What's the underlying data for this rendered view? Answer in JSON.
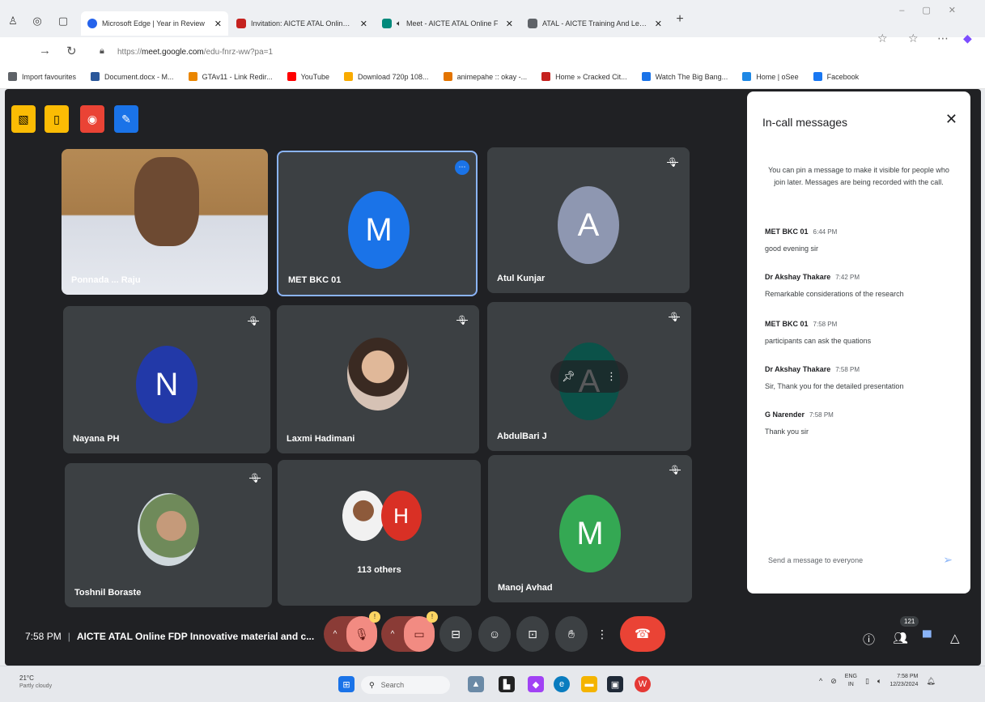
{
  "browser": {
    "tabs": [
      {
        "title": "Microsoft Edge | Year in Review",
        "color": "#2563eb",
        "active": true
      },
      {
        "title": "Invitation: AICTE ATAL Online FDP",
        "color": "#c5221f",
        "active": false
      },
      {
        "title": "Meet - AICTE ATAL Online F",
        "color": "#00897b",
        "active": false
      },
      {
        "title": "ATAL - AICTE Training And Learn",
        "color": "#5f6368",
        "active": false
      }
    ],
    "url_prefix": "https://",
    "url_domain": "meet.google.com",
    "url_path": "/edu-fnrz-ww?pa=1",
    "bookmarks": [
      {
        "label": "Import favourites",
        "color": "#5f6368"
      },
      {
        "label": "Document.docx - M...",
        "color": "#2b579a"
      },
      {
        "label": "GTAv11 - Link Redir...",
        "color": "#ea8600"
      },
      {
        "label": "YouTube",
        "color": "#ff0000"
      },
      {
        "label": "Download 720p 108...",
        "color": "#f9ab00"
      },
      {
        "label": "animepahe :: okay -...",
        "color": "#e37400"
      },
      {
        "label": "Home » Cracked Cit...",
        "color": "#c5221f"
      },
      {
        "label": "Watch The Big Bang...",
        "color": "#1a73e8"
      },
      {
        "label": "Home | oSee",
        "color": "#1e88e5"
      },
      {
        "label": "Facebook",
        "color": "#1877f2"
      }
    ]
  },
  "meet": {
    "participants": [
      {
        "name": "Ponnada ... Raju",
        "type": "photo",
        "muted": false
      },
      {
        "name": "MET BKC 01",
        "type": "avatar",
        "initial": "M",
        "color": "#1a73e8",
        "muted": false,
        "selected": true
      },
      {
        "name": "Atul Kunjar",
        "type": "avatar",
        "initial": "A",
        "color": "#8e97b1",
        "muted": true
      },
      {
        "name": "Nayana PH",
        "type": "avatar",
        "initial": "N",
        "color": "#2239a8",
        "muted": true
      },
      {
        "name": "Laxmi Hadimani",
        "type": "photo",
        "muted": true
      },
      {
        "name": "AbdulBari J",
        "type": "avatar",
        "initial": "A",
        "color": "#0b5249",
        "muted": true
      },
      {
        "name": "Toshnil Boraste",
        "type": "photo",
        "muted": true
      },
      {
        "name": "113 others",
        "type": "others",
        "initial": "H",
        "color": "#d93025",
        "muted": false
      },
      {
        "name": "Manoj Avhad",
        "type": "avatar",
        "initial": "M",
        "color": "#34a853",
        "muted": true
      }
    ],
    "clock": "7:58 PM",
    "meeting_title": "AICTE ATAL Online FDP Innovative material and c...",
    "participant_count": "121",
    "mic_badge": "!",
    "cam_badge": "!"
  },
  "chat": {
    "title": "In-call messages",
    "note": "You can pin a message to make it visible for people who join later. Messages are being recorded with the call.",
    "messages": [
      {
        "sender": "MET BKC 01",
        "time": "6:44 PM",
        "text": "good evening sir"
      },
      {
        "sender": "Dr Akshay Thakare",
        "time": "7:42 PM",
        "text": "Remarkable considerations of the research"
      },
      {
        "sender": "MET BKC 01",
        "time": "7:58 PM",
        "text": "participants can ask the quations"
      },
      {
        "sender": "Dr Akshay Thakare",
        "time": "7:58 PM",
        "text": "Sir, Thank you for the detailed presentation"
      },
      {
        "sender": "G Narender",
        "time": "7:58 PM",
        "text": "Thank you sir"
      }
    ],
    "input_placeholder": "Send a message to everyone"
  },
  "taskbar": {
    "temp": "21°C",
    "weather": "Partly cloudy",
    "search": "Search",
    "lang_top": "ENG",
    "lang_bottom": "IN",
    "time": "7:58 PM",
    "date": "12/23/2024"
  }
}
